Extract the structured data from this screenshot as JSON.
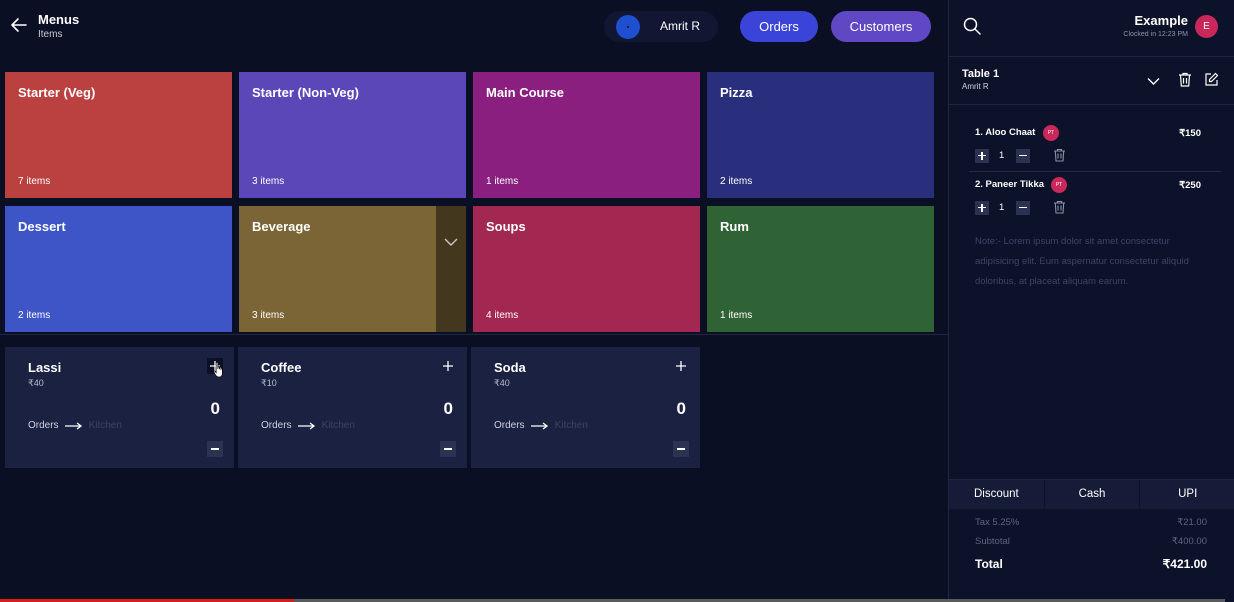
{
  "header": {
    "title": "Menus",
    "subtitle": "Items",
    "user_name": "Amrit R",
    "orders_label": "Orders",
    "customers_label": "Customers"
  },
  "categories": [
    {
      "name": "Starter (Veg)",
      "count": "7 items",
      "color": "#bb4141"
    },
    {
      "name": "Starter (Non-Veg)",
      "count": "3 items",
      "color": "#5b47b8"
    },
    {
      "name": "Main Course",
      "count": "1 items",
      "color": "#8a1f80"
    },
    {
      "name": "Pizza",
      "count": "2 items",
      "color": "#2a2f7d"
    },
    {
      "name": "Dessert",
      "count": "2 items",
      "color": "#3d55c7"
    },
    {
      "name": "Beverage",
      "count": "3 items",
      "color": "#7b6536"
    },
    {
      "name": "Soups",
      "count": "4 items",
      "color": "#a32851"
    },
    {
      "name": "Rum",
      "count": "1 items",
      "color": "#2f6335"
    }
  ],
  "items": [
    {
      "name": "Lassi",
      "price": "₹40",
      "qty": "0",
      "from": "Orders",
      "to": "Kitchen"
    },
    {
      "name": "Coffee",
      "price": "₹10",
      "qty": "0",
      "from": "Orders",
      "to": "Kitchen"
    },
    {
      "name": "Soda",
      "price": "₹40",
      "qty": "0",
      "from": "Orders",
      "to": "Kitchen"
    }
  ],
  "panel": {
    "restaurant_name": "Example",
    "clock_status": "Clocked in 12:23 PM",
    "avatar_letter": "E",
    "table_title": "Table 1",
    "table_user": "Amrit R",
    "order_lines": [
      {
        "name": "1.  Aloo Chaat",
        "badge": "PT",
        "price": "₹150",
        "qty": "1"
      },
      {
        "name": "2.  Paneer Tikka",
        "badge": "PT",
        "price": "₹250",
        "qty": "1"
      }
    ],
    "note": "Note:- Lorem ipsum dolor sit amet consectetur adipisicing elit. Eum aspernatur consectetur aliquid doloribus, at placeat aliquam earum.",
    "pay_buttons": [
      "Discount",
      "Cash",
      "UPI"
    ],
    "tax_label": "Tax 5.25%",
    "tax_value": "₹21.00",
    "subtotal_label": "Subtotal",
    "subtotal_value": "₹400.00",
    "total_label": "Total",
    "total_value": "₹421.00"
  },
  "video_progress": 0.24
}
